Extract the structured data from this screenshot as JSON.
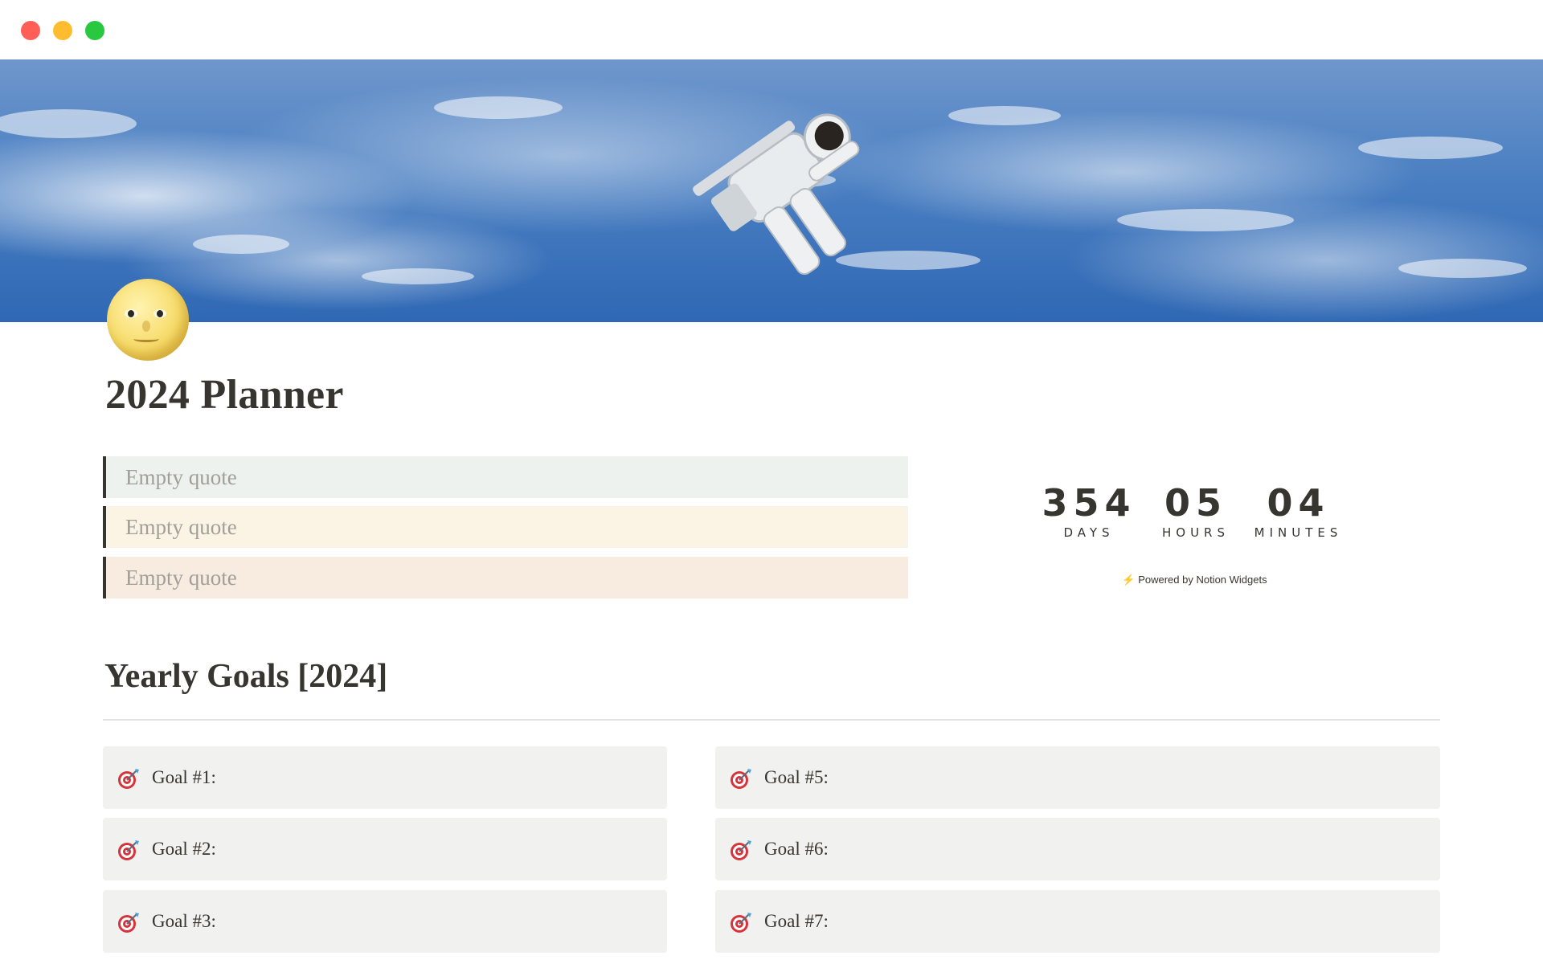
{
  "window": {
    "controls": [
      "close",
      "minimize",
      "zoom"
    ],
    "colors": {
      "close": "#ff5f57",
      "minimize": "#febc2e",
      "zoom": "#28c840"
    }
  },
  "cover": {
    "subject": "astronaut floating above clouds"
  },
  "page": {
    "icon": "full-moon-face-icon",
    "title": "2024 Planner"
  },
  "quotes": [
    {
      "text": "Empty quote",
      "color": "#eef2ee"
    },
    {
      "text": "Empty quote",
      "color": "#fbf4e4"
    },
    {
      "text": "Empty quote",
      "color": "#f8ece0"
    }
  ],
  "countdown": {
    "days": "354",
    "days_label": "DAYS",
    "hours": "05",
    "hours_label": "HOURS",
    "minutes": "04",
    "minutes_label": "MINUTES",
    "powered_by": "Powered by Notion Widgets",
    "powered_icon": "lightning-icon"
  },
  "goals_section": {
    "title": "Yearly Goals [2024]",
    "goal_icon": "direct-hit-target-icon",
    "left": [
      {
        "label": "Goal #1:"
      },
      {
        "label": "Goal #2:"
      },
      {
        "label": "Goal #3:"
      }
    ],
    "right": [
      {
        "label": "Goal #5:"
      },
      {
        "label": "Goal #6:"
      },
      {
        "label": "Goal #7:"
      }
    ]
  }
}
